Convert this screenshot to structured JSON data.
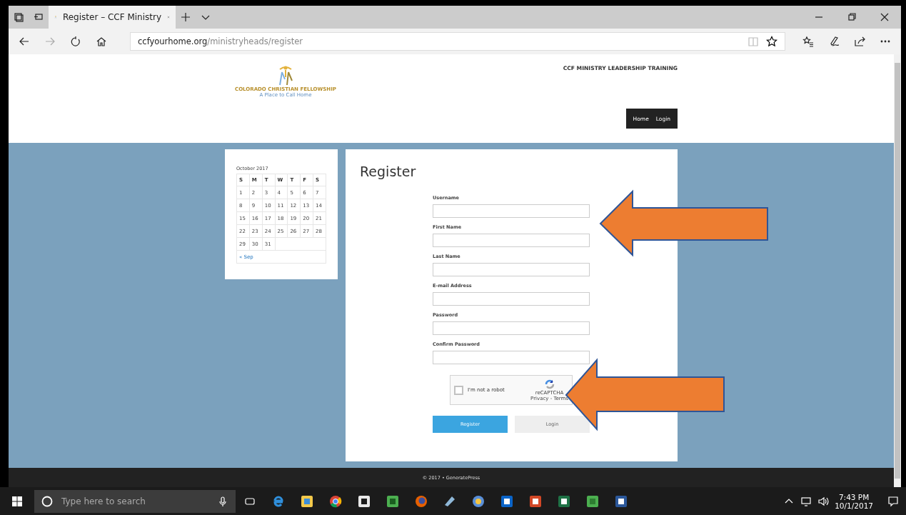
{
  "browser": {
    "tab_title": "Register – CCF Ministry",
    "url_host": "ccfyourhome.org",
    "url_path": "/ministryheads/register"
  },
  "header": {
    "logo_name": "COLORADO CHRISTIAN FELLOWSHIP",
    "logo_tagline": "A Place to Call Home",
    "site_title": "CCF MINISTRY LEADERSHIP TRAINING",
    "nav": [
      {
        "label": "Home"
      },
      {
        "label": "Login"
      }
    ]
  },
  "calendar": {
    "caption": "October 2017",
    "weekdays": [
      "S",
      "M",
      "T",
      "W",
      "T",
      "F",
      "S"
    ],
    "weeks": [
      [
        "1",
        "2",
        "3",
        "4",
        "5",
        "6",
        "7"
      ],
      [
        "8",
        "9",
        "10",
        "11",
        "12",
        "13",
        "14"
      ],
      [
        "15",
        "16",
        "17",
        "18",
        "19",
        "20",
        "21"
      ],
      [
        "22",
        "23",
        "24",
        "25",
        "26",
        "27",
        "28"
      ],
      [
        "29",
        "30",
        "31"
      ]
    ],
    "prev_link": "« Sep"
  },
  "register": {
    "title": "Register",
    "fields": [
      {
        "label": "Username"
      },
      {
        "label": "First Name"
      },
      {
        "label": "Last Name"
      },
      {
        "label": "E-mail Address"
      },
      {
        "label": "Password"
      },
      {
        "label": "Confirm Password"
      }
    ],
    "captcha": {
      "label": "I'm not a robot",
      "checked": false,
      "brand": "reCAPTCHA",
      "links": "Privacy - Terms"
    },
    "buttons": [
      {
        "label": "Register",
        "kind": "primary"
      },
      {
        "label": "Login",
        "kind": "secondary"
      }
    ]
  },
  "footer": "© 2017 • GeneratePress",
  "taskbar": {
    "search_placeholder": "Type here to search",
    "time": "7:43 PM",
    "date": "10/1/2017"
  }
}
